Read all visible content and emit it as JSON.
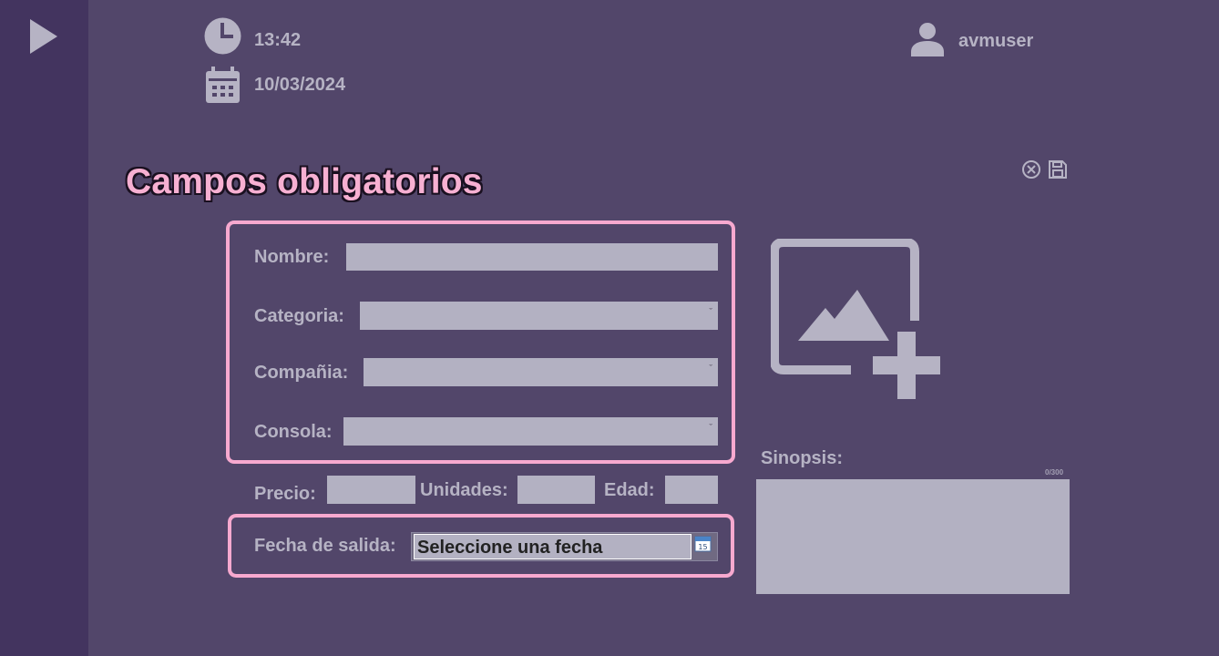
{
  "header": {
    "time": "13:42",
    "date": "10/03/2024",
    "username": "avmuser"
  },
  "title": "Campos obligatorios",
  "form": {
    "nombre_label": "Nombre:",
    "categoria_label": "Categoria:",
    "compania_label": "Compañia:",
    "consola_label": "Consola:",
    "precio_label": "Precio:",
    "unidades_label": "Unidades:",
    "edad_label": "Edad:",
    "fecha_label": "Fecha de salida:",
    "fecha_value": "Seleccione una fecha",
    "sinopsis_label": "Sinopsis:",
    "sinopsis_counter": "0/300",
    "nombre_value": "",
    "categoria_value": "",
    "compania_value": "",
    "consola_value": "",
    "precio_value": "",
    "unidades_value": "",
    "edad_value": "",
    "sinopsis_value": ""
  },
  "icons": {
    "sidebar_toggle": "play-icon",
    "clock": "clock-icon",
    "calendar": "calendar-icon",
    "user": "user-icon",
    "close": "close-circle-icon",
    "save": "save-icon",
    "add_image": "add-image-icon",
    "date_picker": "calendar-picker-icon"
  },
  "colors": {
    "background": "#52466a",
    "sidebar": "#43345f",
    "accent_pink": "#f7a9cf",
    "text_muted": "#b6b3c4",
    "field": "#b3b1c2"
  }
}
